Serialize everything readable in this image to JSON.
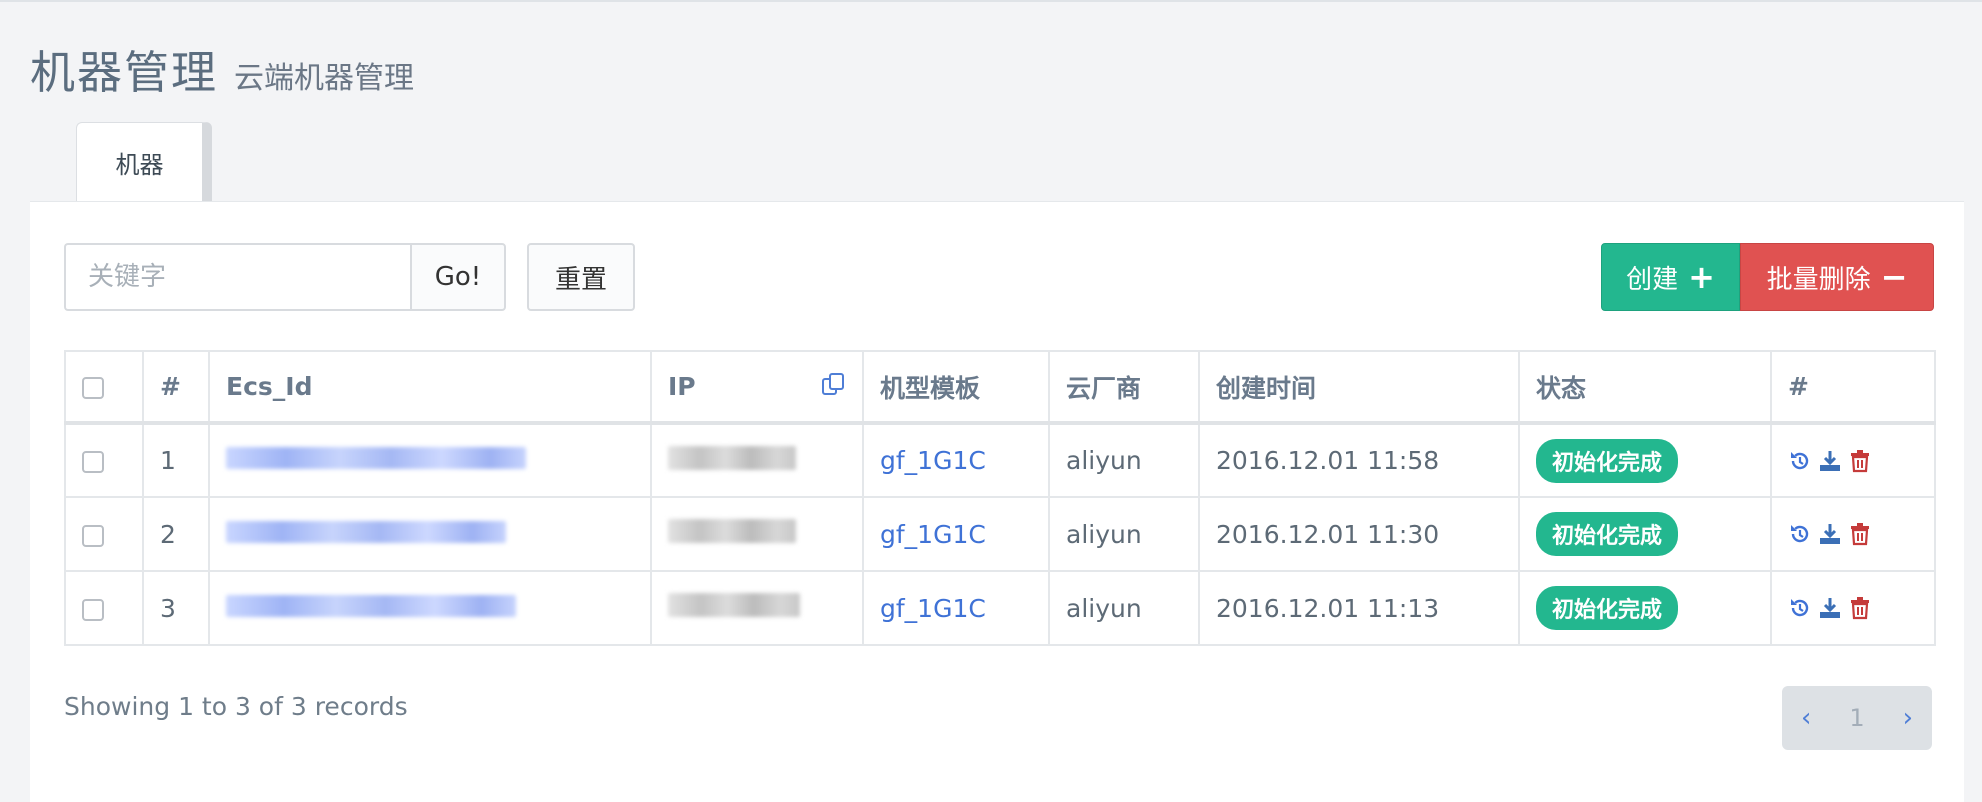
{
  "header": {
    "title": "机器管理",
    "subtitle": "云端机器管理"
  },
  "tabs": [
    {
      "label": "机器",
      "active": true
    }
  ],
  "toolbar": {
    "search_placeholder": "关键字",
    "search_value": "",
    "go_label": "Go!",
    "reset_label": "重置",
    "create_label": "创建",
    "create_sign": "+",
    "batch_delete_label": "批量删除",
    "batch_delete_sign": "−"
  },
  "table": {
    "headers": {
      "index": "#",
      "ecs_id": "Ecs_Id",
      "ip": "IP",
      "template": "机型模板",
      "provider": "云厂商",
      "created": "创建时间",
      "status": "状态",
      "actions": "#"
    },
    "rows": [
      {
        "index": "1",
        "template": "gf_1G1C",
        "provider": "aliyun",
        "created": "2016.12.01 11:58",
        "status": "初始化完成"
      },
      {
        "index": "2",
        "template": "gf_1G1C",
        "provider": "aliyun",
        "created": "2016.12.01 11:30",
        "status": "初始化完成"
      },
      {
        "index": "3",
        "template": "gf_1G1C",
        "provider": "aliyun",
        "created": "2016.12.01 11:13",
        "status": "初始化完成"
      }
    ]
  },
  "footer": {
    "showing_text": "Showing 1 to 3 of 3 records",
    "prev": "‹",
    "current_page": "1",
    "next": "›"
  },
  "colors": {
    "accent_green": "#23b78f",
    "danger_red": "#e05251",
    "link_blue": "#3f72d6"
  }
}
